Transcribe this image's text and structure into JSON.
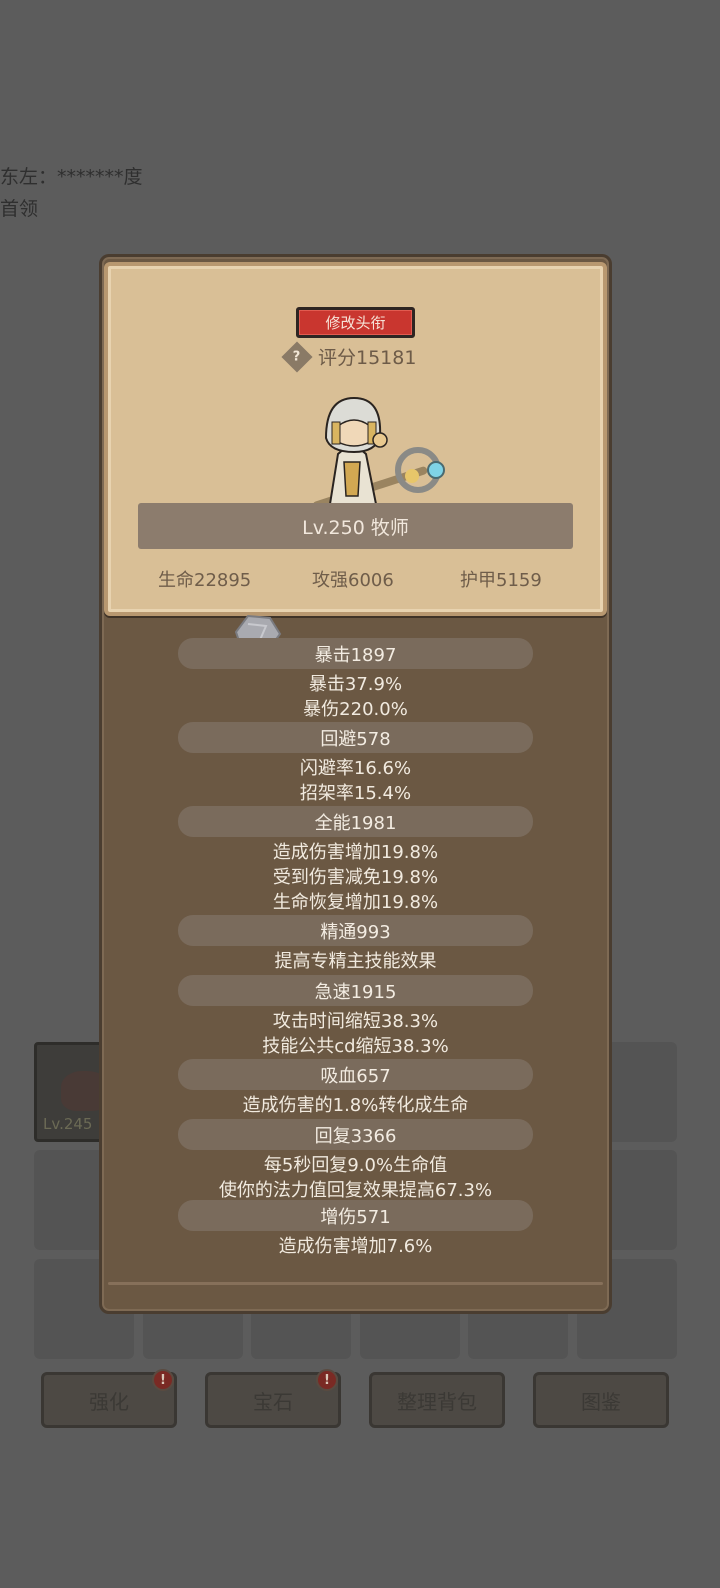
{
  "background": {
    "text_line1": "东左：*******度",
    "text_line2": "首领",
    "item_level": "Lv.245",
    "buttons": [
      {
        "label": "强化",
        "badge": "!"
      },
      {
        "label": "宝石",
        "badge": "!"
      },
      {
        "label": "整理背包",
        "badge": ""
      },
      {
        "label": "图鉴",
        "badge": ""
      }
    ]
  },
  "profile": {
    "rename_button": "修改头衔",
    "help_symbol": "?",
    "score": "评分15181",
    "class_level": "Lv.250 牧师",
    "base_stats": {
      "hp": "生命22895",
      "attack": "攻强6006",
      "armor": "护甲5159"
    }
  },
  "stats": {
    "crit": {
      "header": "暴击1897",
      "lines": [
        "暴击37.9%",
        "暴伤220.0%"
      ]
    },
    "dodge": {
      "header": "回避578",
      "lines": [
        "闪避率16.6%",
        "招架率15.4%"
      ]
    },
    "versatility": {
      "header": "全能1981",
      "lines": [
        "造成伤害增加19.8%",
        "受到伤害减免19.8%",
        "生命恢复增加19.8%"
      ]
    },
    "mastery": {
      "header": "精通993",
      "lines": [
        "提高专精主技能效果"
      ]
    },
    "haste": {
      "header": "急速1915",
      "lines": [
        "攻击时间缩短38.3%",
        "技能公共cd缩短38.3%"
      ]
    },
    "lifesteal": {
      "header": "吸血657",
      "lines": [
        "造成伤害的1.8%转化成生命"
      ]
    },
    "regen": {
      "header": "回复3366",
      "lines": [
        "每5秒回复9.0%生命值",
        "使你的法力值回复效果提高67.3%"
      ]
    },
    "dmg_bonus": {
      "header": "增伤571",
      "lines": [
        "造成伤害增加7.6%"
      ]
    }
  },
  "colors": {
    "rename_red": "#c9362f",
    "parchment": "#d9bf96",
    "panel_brown": "#6b5843"
  }
}
